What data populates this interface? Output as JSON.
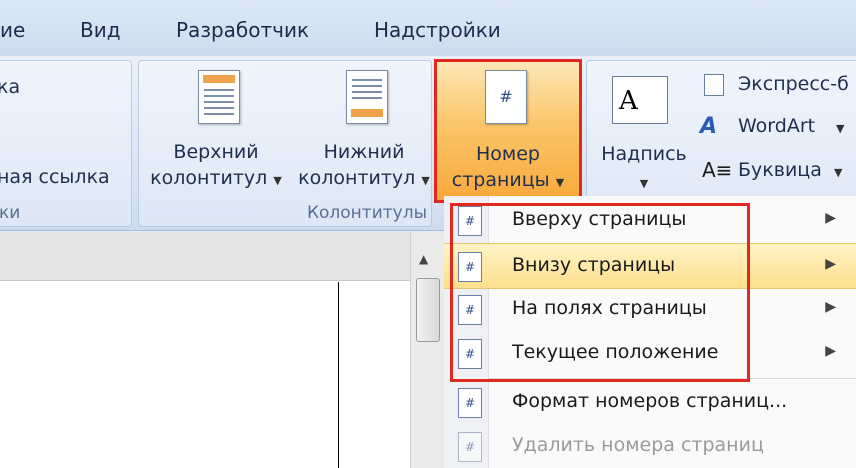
{
  "tabs": [
    "ие",
    "Вид",
    "Разработчик",
    "Надстройки"
  ],
  "ribbon": {
    "left_group": {
      "line1": "ка",
      "line2": "ная ссылка",
      "label": "ки"
    },
    "header": {
      "line1": "Верхний",
      "line2": "колонтитул"
    },
    "footer": {
      "line1": "Нижний",
      "line2": "колонтитул"
    },
    "headers_group_label": "Колонтитулы",
    "page_number": {
      "line1": "Номер",
      "line2": "страницы",
      "icon_glyph": "#"
    },
    "textbox": {
      "label": "Надпись",
      "icon_glyph": "A"
    },
    "express": "Экспресс-б",
    "wordart": "WordArt",
    "dropcap": "Буквица"
  },
  "menu": {
    "items": [
      {
        "label": "Вверху страницы",
        "icon": "page-top-icon",
        "submenu": true
      },
      {
        "label": "Внизу страницы",
        "icon": "page-bottom-icon",
        "submenu": true
      },
      {
        "label": "На полях страницы",
        "icon": "page-margins-icon",
        "submenu": true
      },
      {
        "label": "Текущее положение",
        "icon": "current-position-icon",
        "submenu": true
      },
      {
        "label": "Формат номеров страниц...",
        "icon": "format-numbers-icon",
        "submenu": false
      },
      {
        "label": "Удалить номера страниц",
        "icon": "remove-numbers-icon",
        "submenu": false,
        "disabled": true
      }
    ],
    "icon_glyph": "#",
    "submenu_glyph": "▶"
  },
  "colors": {
    "highlight_border": "#e0281f",
    "hover": "#fde08d",
    "ribbon_text": "#1f2f4f"
  }
}
